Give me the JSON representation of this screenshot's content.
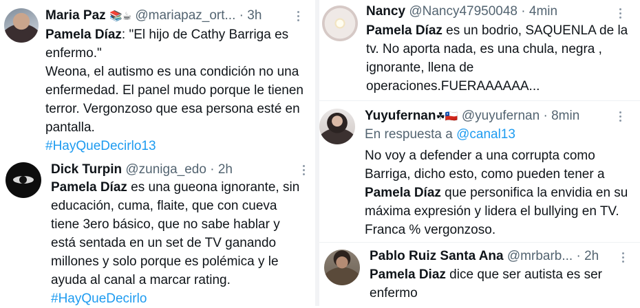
{
  "tweets": [
    {
      "name": "Maria Paz",
      "emoji": "📚☕",
      "handle": "@mariapaz_ort...",
      "dot": "·",
      "time": "3h",
      "lead_bold": "Pamela Díaz",
      "lead_rest": ": \"El hijo de Cathy Barriga es enfermo.\"",
      "text": "Weona, el autismo es una condición no una enfermedad. El panel mudo porque le tienen terror. Vergonzoso que esa persona esté en pantalla.",
      "hashtag": "#HayQueDecirlo13"
    },
    {
      "name": "Dick Turpin",
      "handle": "@zuniga_edo",
      "dot": "·",
      "time": "2h",
      "lead_bold": "Pamela Díaz",
      "text": " es una gueona  ignorante, sin educación, cuma, flaite, que con cueva tiene 3ero básico, que no sabe hablar y está sentada en un set de TV ganando millones y solo porque es polémica y le ayuda al canal a marcar rating. ",
      "hashtag": "#HayQueDecirlo"
    },
    {
      "name": "Nancy",
      "handle": "@Nancy47950048",
      "dot": "·",
      "time": "4min",
      "lead_bold": "Pamela Díaz",
      "text": " es un bodrio, SAQUENLA de la tv. No aporta nada, es una chula, negra , ignorante, llena de operaciones.FUERAAAAAA..."
    },
    {
      "name": "Yuyufernan",
      "emoji": "☘🇨🇱",
      "handle": "@yuyufernan",
      "dot": "·",
      "time": "8min",
      "reply_prefix": "En respuesta a",
      "reply_mention": "@canal13",
      "text_before": "No voy a defender a una corrupta como Barriga, dicho esto, como pueden tener a ",
      "lead_bold": "Pamela Díaz",
      "text_after": " que personifica la envidia en su máxima expresión y lidera el bullying en TV. Franca % vergonzoso."
    },
    {
      "name": "Pablo Ruiz Santa Ana",
      "handle": "@mrbarb...",
      "dot": "·",
      "time": "2h",
      "lead_bold": "Pamela Diaz",
      "text": " dice que ser autista es ser enfermo"
    }
  ]
}
